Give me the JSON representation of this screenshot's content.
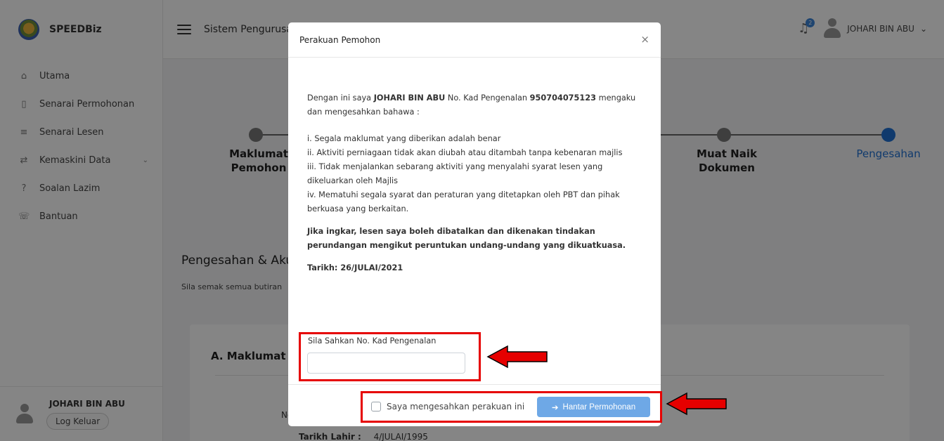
{
  "sidebar": {
    "brand": "SPEEDBiz",
    "items": [
      {
        "label": "Utama",
        "icon": "home-icon"
      },
      {
        "label": "Senarai Permohonan",
        "icon": "document-icon"
      },
      {
        "label": "Senarai Lesen",
        "icon": "list-icon"
      },
      {
        "label": "Kemaskini Data",
        "icon": "refresh-icon"
      },
      {
        "label": "Soalan Lazim",
        "icon": "question-icon"
      },
      {
        "label": "Bantuan",
        "icon": "phone-icon"
      }
    ],
    "user_name": "JOHARI BIN ABU",
    "logout_label": "Log Keluar"
  },
  "header": {
    "system_title": "Sistem Pengurusan",
    "notification_count": "2",
    "user_name": "JOHARI BIN ABU"
  },
  "stepper": {
    "steps": [
      {
        "label1": "Maklumat",
        "label2": "Pemohon"
      },
      {
        "label1": "Muat Naik",
        "label2": "Dokumen"
      },
      {
        "label1": "Pengesahan",
        "label2": ""
      }
    ]
  },
  "page": {
    "section_title": "Pengesahan & Akuan",
    "section_subtitle": "Sila semak semua butiran",
    "card_title": "A. Maklumat Pemohon",
    "card_no_label": "No",
    "dob_label": "Tarikh Lahir :",
    "dob_value": "4/JULAI/1995"
  },
  "modal": {
    "title": "Perakuan Pemohon",
    "close_symbol": "×",
    "intro_pre": "Dengan ini saya ",
    "intro_name": "JOHARI BIN ABU",
    "intro_mid": " No. Kad Pengenalan ",
    "intro_ic": "950704075123",
    "intro_post": " mengaku dan mengesahkan bahawa :",
    "clauses": [
      "i. Segala maklumat yang diberikan adalah benar",
      "ii. Aktiviti perniagaan tidak akan diubah atau ditambah tanpa kebenaran majlis",
      "iii. Tidak menjalankan sebarang aktiviti yang menyalahi syarat lesen yang dikeluarkan oleh Majlis",
      "iv. Mematuhi segala syarat dan peraturan yang ditetapkan oleh PBT dan pihak berkuasa yang berkaitan."
    ],
    "warning": "Jika ingkar, lesen saya boleh dibatalkan dan dikenakan tindakan perundangan mengikut peruntukan undang-undang yang dikuatkuasa.",
    "date_text": "Tarikh: 26/JULAI/2021",
    "verify_label": "Sila Sahkan No. Kad Pengenalan",
    "verify_value": "",
    "checkbox_label": "Saya mengesahkan perakuan ini",
    "submit_label": "Hantar Permohonan"
  },
  "colors": {
    "accent": "#1f6fd1",
    "submit_button": "#6ea8e6",
    "annotation": "#e60000"
  }
}
